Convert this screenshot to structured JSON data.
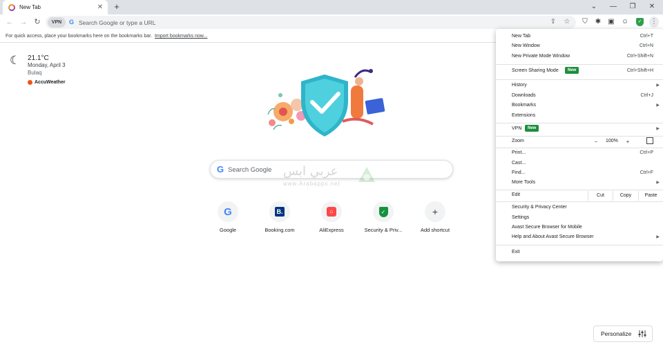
{
  "tab": {
    "title": "New Tab"
  },
  "omnibox": {
    "vpn_label": "VPN",
    "placeholder": "Search Google or type a URL"
  },
  "bookmarks_bar": {
    "text": "For quick access, place your bookmarks here on the bookmarks bar.",
    "import_link": "Import bookmarks now..."
  },
  "weather": {
    "temp": "21.1°C",
    "date": "Monday, April 3",
    "location": "Bulaq",
    "provider": "AccuWeather"
  },
  "search": {
    "placeholder": "Search Google"
  },
  "watermark": {
    "arabic": "عربي ابس",
    "url": "www.Arabapps.net"
  },
  "shortcuts": [
    {
      "label": "Google",
      "icon": "G"
    },
    {
      "label": "Booking.com",
      "icon": "B."
    },
    {
      "label": "AliExpress",
      "icon": "⌂"
    },
    {
      "label": "Security & Priv...",
      "icon": "✓"
    },
    {
      "label": "Add shortcut",
      "icon": "+"
    }
  ],
  "personalize": {
    "label": "Personalize"
  },
  "menu": {
    "new_tab": {
      "label": "New Tab",
      "shortcut": "Ctrl+T"
    },
    "new_window": {
      "label": "New Window",
      "shortcut": "Ctrl+N"
    },
    "new_private": {
      "label": "New Private Mode Window",
      "shortcut": "Ctrl+Shift+N"
    },
    "screen_sharing": {
      "label": "Screen Sharing Mode",
      "badge": "New",
      "shortcut": "Ctrl+Shift+H"
    },
    "history": {
      "label": "History"
    },
    "downloads": {
      "label": "Downloads",
      "shortcut": "Ctrl+J"
    },
    "bookmarks": {
      "label": "Bookmarks"
    },
    "extensions": {
      "label": "Extensions"
    },
    "vpn": {
      "label": "VPN",
      "badge": "New"
    },
    "zoom": {
      "label": "Zoom",
      "minus": "−",
      "value": "100%",
      "plus": "+"
    },
    "print": {
      "label": "Print...",
      "shortcut": "Ctrl+P"
    },
    "cast": {
      "label": "Cast..."
    },
    "find": {
      "label": "Find...",
      "shortcut": "Ctrl+F"
    },
    "more_tools": {
      "label": "More Tools"
    },
    "edit": {
      "label": "Edit",
      "cut": "Cut",
      "copy": "Copy",
      "paste": "Paste"
    },
    "security_center": {
      "label": "Security & Privacy Center"
    },
    "settings": {
      "label": "Settings"
    },
    "mobile": {
      "label": "Avast Secure Browser for Mobile"
    },
    "help": {
      "label": "Help and About Avast Secure Browser"
    },
    "exit": {
      "label": "Exit"
    }
  },
  "colors": {
    "accent_green": "#1e8e3e",
    "tabstrip": "#dee1e6",
    "omnibox": "#f1f3f4"
  }
}
